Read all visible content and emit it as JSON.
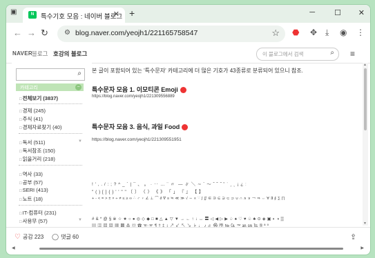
{
  "browser": {
    "tab_title": "특수기호 모음 : 네이버 블로그",
    "favicon_text": "N",
    "url": "blog.naver.com/yeojh1/221165758547",
    "newtab_glyph": "+"
  },
  "blog_header": {
    "naver_logo": "NAVER",
    "blog_word": "블로그",
    "blog_name": "호강의 블로그",
    "search_placeholder": "이 블로그에서 검색"
  },
  "sidebar": {
    "category_header": "카테고리",
    "items": [
      {
        "label": "전체보기 (3837)"
      },
      {
        "label": "경제 (245)"
      },
      {
        "label": "주식 (41)"
      },
      {
        "label": "경제자료찾기 (40)"
      },
      {
        "label": "독서 (511)"
      },
      {
        "label": "독서참조 (150)"
      },
      {
        "label": "읽을거리 (218)"
      },
      {
        "label": "역사 (33)"
      },
      {
        "label": "공부 (57)"
      },
      {
        "label": "SERI (413)"
      },
      {
        "label": "노트 (18)"
      },
      {
        "label": "IT-컴퓨터 (231)"
      },
      {
        "label": "사용무 (57)"
      }
    ]
  },
  "content": {
    "intro": "본 글이 포함되어 있는 '특수문자' 카테고리에 더 많은 기호가 43종류로 분류되어 있으니 참조.",
    "section1_title": "특수문자 모음 1. 이모티콘 Emoji",
    "section1_link": "https://blog.naver.com/yeojh1/221309556889",
    "section3_title": "특수문자 모음 3. 음식, 과일 Food",
    "section3_link": "https://blog.naver.com/yeojh1/221309551951",
    "symbols_line1": "! ' , . / : ; ? ^ _ ` | ¯ 、 。 · ‥ … ¨ 〃 ­ ― ∥ ＼ ∼ ´ ～ ˇ ˘ ˝ ˚ ˙ ¸ ˛ ¡ ¿ ː",
    "symbols_line2": "\" ( ) [ ] { } ' ' \" \" 〔 〕 〈 〉 《 》 「 」 『 』 【 】",
    "symbols_line3": "+ - < = > ± × ÷ ≠ ≤ ≥ ∞ ∴ ♂ ♀ ∠ ⊥ ⌒ ∂ ∇ ≡ ≒ ≪ ≫ √ ∽ ∝ ∵ ∫ ∬ ∈ ∋ ⊆ ⊇ ⊂ ⊃ ∪ ∩ ∧ ∨ ￢ ⇒ ⇔ ∀ ∃ ∮ ∑ ∏",
    "symbols_line4": "# & * @ § ※ ☆ ★ ○ ● ◎ ◇ ◆ □ ■ △ ▲ ▽ ▼ → ← ↑ ↓ ↔ 〓 ◁ ◀ ▷ ▶ ♤ ♠ ♡ ♥ ♧ ♣ ⊙ ◈ ▣ ◐ ◑ ▒",
    "symbols_line5": "▤ ▥ ▨ ▧ ▦ ▩ ♨ ☏ ☎ ☜ ☞ ¶ † ‡ ↕ ↗ ↙ ↖ ↘ ♭ ♩ ♪ ♬ ㉿ ㈜ № ㏇ ™ ㏂ ㏘ ℡ ® ª º"
  },
  "actions": {
    "like_label": "공감 223",
    "comment_label": "댓글 60"
  }
}
